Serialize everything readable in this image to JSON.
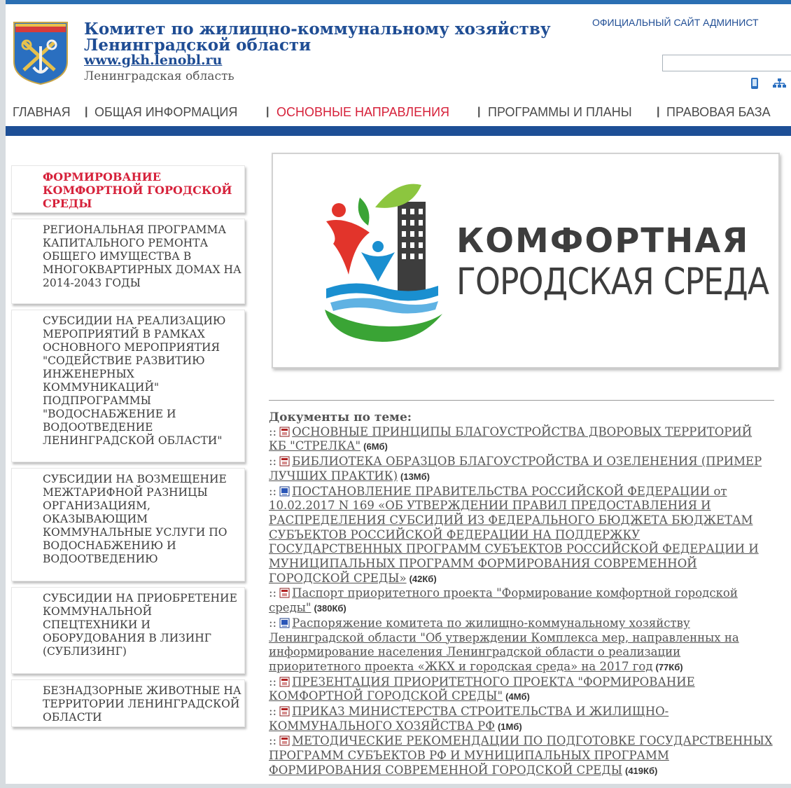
{
  "header": {
    "title": "Комитет по жилищно-коммунальному хозяйству Ленинградской области",
    "url": "www.gkh.lenobl.ru",
    "region": "Ленинградская область",
    "official_link": "ОФИЦИАЛЬНЫЙ САЙТ АДМИНИСТ",
    "search_value": ""
  },
  "nav": [
    {
      "label": "ГЛАВНАЯ"
    },
    {
      "label": "ОБЩАЯ ИНФОРМАЦИЯ"
    },
    {
      "label": "ОСНОВНЫЕ НАПРАВЛЕНИЯ",
      "active": true
    },
    {
      "label": "ПРОГРАММЫ И ПЛАНЫ"
    },
    {
      "label": "ПРАВОВАЯ БАЗА"
    }
  ],
  "sidebar": [
    {
      "label": "Формирование комфортной городской среды",
      "active": true
    },
    {
      "label": "Региональная программа капитального ремонта общего имущества в многоквартирных домах на 2014-2043 годы"
    },
    {
      "label": "Субсидии на реализацию мероприятий в рамках основного мероприятия \"Содействие развитию инженерных коммуникаций\" подпрограммы \"Водоснабжение и водоотведение Ленинградской области\""
    },
    {
      "label": "Субсидии на возмещение межтарифной разницы организациям, оказывающим коммунальные услуги по водоснабжению и водоотведению"
    },
    {
      "label": "Субсидии на приобретение коммунальной спецтехники и оборудования в лизинг (сублизинг)"
    },
    {
      "label": "Безнадзорные животные на территории Ленинградской области"
    }
  ],
  "banner": {
    "line1": "КОМФОРТНАЯ",
    "line2": "ГОРОДСКАЯ СРЕДА",
    "colors": {
      "red": "#e2342b",
      "green": "#3aa435",
      "blue": "#1a8fd0",
      "dark": "#3d3d3d"
    }
  },
  "docs": {
    "heading": "Документы по теме:",
    "items": [
      {
        "type": "pdf",
        "title": "ОСНОВНЫЕ ПРИНЦИПЫ БЛАГОУСТРОЙСТВА ДВОРОВЫХ ТЕРРИТОРИЙ КБ \"СТРЕЛКА\"",
        "size": "(6Мб)"
      },
      {
        "type": "pdf",
        "title": "БИБЛИОТЕКА ОБРАЗЦОВ БЛАГОУСТРОЙСТВА И ОЗЕЛЕНЕНИЯ (ПРИМЕР ЛУЧШИХ ПРАКТИК)",
        "size": "(13Мб)"
      },
      {
        "type": "doc",
        "title": "ПОСТАНОВЛЕНИЕ ПРАВИТЕЛЬСТВА РОССИЙСКОЙ ФЕДЕРАЦИИ от 10.02.2017 N 169 «ОБ УТВЕРЖДЕНИИ ПРАВИЛ ПРЕДОСТАВЛЕНИЯ И РАСПРЕДЕЛЕНИЯ СУБСИДИЙ ИЗ ФЕДЕРАЛЬНОГО БЮДЖЕТА БЮДЖЕТАМ СУБЪЕКТОВ РОССИЙСКОЙ ФЕДЕРАЦИИ НА ПОДДЕРЖКУ ГОСУДАРСТВЕННЫХ ПРОГРАММ СУБЪЕКТОВ РОССИЙСКОЙ ФЕДЕРАЦИИ И МУНИЦИПАЛЬНЫХ ПРОГРАММ ФОРМИРОВАНИЯ СОВРЕМЕННОЙ ГОРОДСКОЙ СРЕДЫ»",
        "size": "(42Кб)"
      },
      {
        "type": "pdf",
        "title": "Паспорт приоритетного проекта \"Формирование комфортной городской среды\"",
        "size": "(380Кб)"
      },
      {
        "type": "doc",
        "title": "Распоряжение комитета по жилищно-коммунальному хозяйству Ленинградской области \"Об утверждении Комплекса мер, направленных на информирование населения Ленинградской области о реализации приоритетного проекта «ЖКХ и городская среда» на 2017 год",
        "size": "(77Кб)"
      },
      {
        "type": "pdf",
        "title": "ПРЕЗЕНТАЦИЯ ПРИОРИТЕТНОГО ПРОЕКТА \"ФОРМИРОВАНИЕ КОМФОРТНОЙ ГОРОДСКОЙ СРЕДЫ\"",
        "size": "(4Мб)"
      },
      {
        "type": "pdf",
        "title": "ПРИКАЗ МИНИСТЕРСТВА СТРОИТЕЛЬСТВА И ЖИЛИЩНО-КОММУНАЛЬНОГО ХОЗЯЙСТВА РФ",
        "size": "(1Мб)"
      },
      {
        "type": "pdf",
        "title": "МЕТОДИЧЕСКИЕ РЕКОМЕНДАЦИИ ПО ПОДГОТОВКЕ ГОСУДАРСТВЕННЫХ ПРОГРАММ СУБЪЕКТОВ РФ И МУНИЦИПАЛЬНЫХ ПРОГРАММ ФОРМИРОВАНИЯ СОВРЕМЕННОЙ ГОРОДСКОЙ СРЕДЫ",
        "size": "(419Кб)"
      }
    ]
  }
}
